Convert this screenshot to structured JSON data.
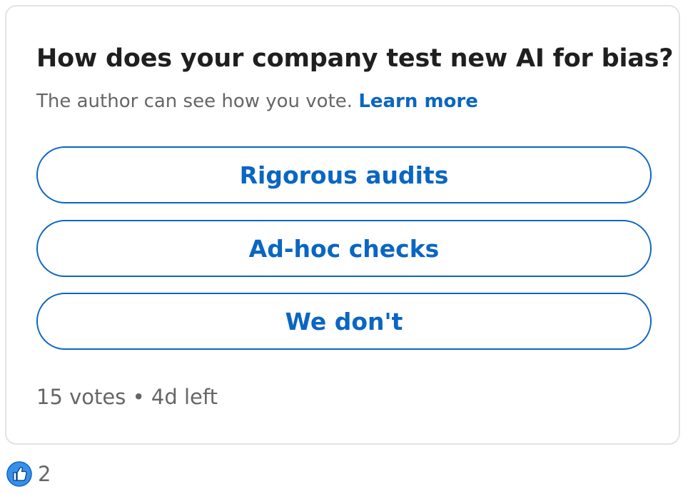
{
  "poll": {
    "question": "How does your company test new AI for bias?",
    "disclosure_text": "The author can see how you vote.",
    "learn_more_label": "Learn more",
    "options": [
      {
        "label": "Rigorous audits"
      },
      {
        "label": "Ad-hoc checks"
      },
      {
        "label": "We don't"
      }
    ],
    "votes_text": "15 votes",
    "separator": "•",
    "time_left_text": "4d left"
  },
  "reactions": {
    "icon": "like-icon",
    "count": "2"
  },
  "colors": {
    "accent": "#0a66c2",
    "text_primary": "#1f1f1f",
    "text_secondary": "#666666",
    "border": "#e3e3e3"
  }
}
